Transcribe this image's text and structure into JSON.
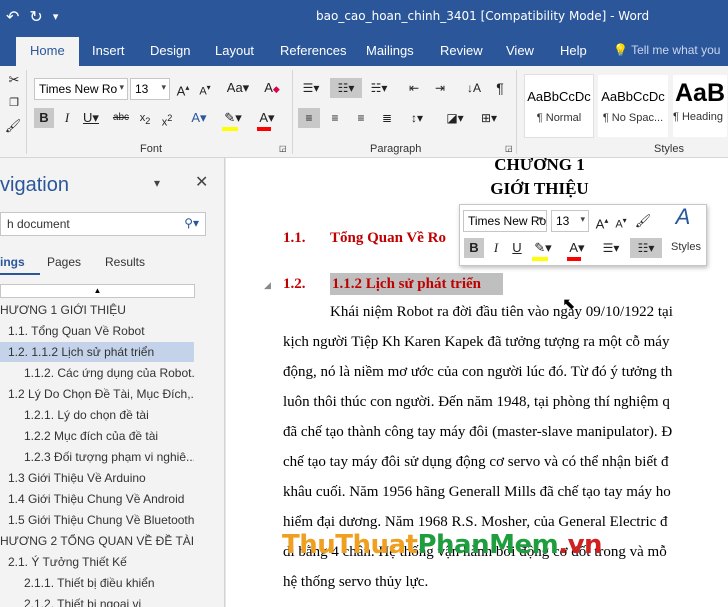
{
  "window": {
    "title": "bao_cao_hoan_chinh_3401 [Compatibility Mode] - Word"
  },
  "quick_access": {
    "undo": "↶",
    "redo": "↻",
    "customize": "▾"
  },
  "tabs": [
    {
      "label": "Home",
      "active": true
    },
    {
      "label": "Insert"
    },
    {
      "label": "Design"
    },
    {
      "label": "Layout"
    },
    {
      "label": "References"
    },
    {
      "label": "Mailings"
    },
    {
      "label": "Review"
    },
    {
      "label": "View"
    },
    {
      "label": "Help"
    }
  ],
  "tell_me": "Tell me what you",
  "ribbon": {
    "font_name": "Times New Ro",
    "font_size": "13",
    "font_group": "Font",
    "paragraph_group": "Paragraph",
    "styles_group": "Styles",
    "styles": [
      {
        "preview": "AaBbCcDc",
        "name": "¶ Normal"
      },
      {
        "preview": "AaBbCcDc",
        "name": "¶ No Spac..."
      },
      {
        "preview": "AaB",
        "name": "Heading"
      }
    ],
    "colors": {
      "highlight": "#ffff00",
      "font_color": "#ff0000",
      "accent": "#2b579a"
    }
  },
  "nav": {
    "title": "vigation",
    "search_placeholder": "h document",
    "tabs": [
      "ings",
      "Pages",
      "Results"
    ],
    "items": [
      {
        "label": "HƯƠNG 1 GIỚI THIỆU",
        "level": 0
      },
      {
        "label": "1.1. Tổng Quan Về Robot",
        "level": 1
      },
      {
        "label": "1.2. 1.1.2 Lịch sử phát triển",
        "level": 1,
        "selected": true
      },
      {
        "label": "1.1.2. Các ứng dụng của Robot.",
        "level": 2
      },
      {
        "label": "1.2 Lý Do Chọn Đề Tài, Mục Đích,...",
        "level": 1
      },
      {
        "label": "1.2.1. Lý do chọn đề tài",
        "level": 2
      },
      {
        "label": "1.2.2 Mục đích của đề tài",
        "level": 2
      },
      {
        "label": "1.2.3 Đối tượng phạm vi nghiê...",
        "level": 2
      },
      {
        "label": "1.3 Giới Thiệu Về Arduino",
        "level": 1
      },
      {
        "label": "1.4 Giới Thiệu Chung Về Android",
        "level": 1
      },
      {
        "label": "1.5 Giới Thiệu Chung Về Bluetooth",
        "level": 1
      },
      {
        "label": "HƯƠNG 2 TỔNG QUAN VỀ ĐỀ TÀI",
        "level": 0
      },
      {
        "label": "2.1. Ý Tưởng Thiết Kế",
        "level": 1
      },
      {
        "label": "2.1.1. Thiết bị điều khiển",
        "level": 2
      },
      {
        "label": "2.1.2. Thiết bị ngoại vi",
        "level": 2
      }
    ]
  },
  "doc": {
    "chapter": "CHƯƠNG 1",
    "chapter_title": "GIỚI THIỆU",
    "h1_num": "1.1.",
    "h1_text": "Tổng Quan Về Ro",
    "h2_num": "1.2.",
    "h2_text": "1.1.2 Lịch sử phát triển",
    "lines": [
      "Khái niệm Robot ra đời đầu tiên vào ngày 09/10/1922 tại",
      "kịch người Tiệp Kh Karen Kapek đã tưởng tượng ra một cỗ máy",
      "động, nó là niềm mơ ước của con người lúc đó. Từ đó ý tưởng th",
      "luôn thôi thúc con người. Đến năm 1948, tại phòng thí nghiệm q",
      "đã chế tạo thành công tay máy đôi (master-slave manipulator). Đ",
      "chế tạo tay máy đôi sử dụng động cơ servo và có thể nhận biết đ",
      "khâu cuối. Năm 1956 hãng Generall Mills đã chế tạo tay máy ho",
      "hiểm đại dương. Năm 1968 R.S. Mosher, của General Electric đ",
      "di bằng 4 chân. Hệ thống vận hành bởi động cơ đốt trong và mỗ",
      "hệ thống servo thủy lực."
    ]
  },
  "mini_toolbar": {
    "font_name": "Times New Ro",
    "font_size": "13",
    "styles_label": "Styles"
  },
  "watermark": {
    "part1": "ThuThuat",
    "part2": "PhanMem",
    "part3": ".vn"
  }
}
